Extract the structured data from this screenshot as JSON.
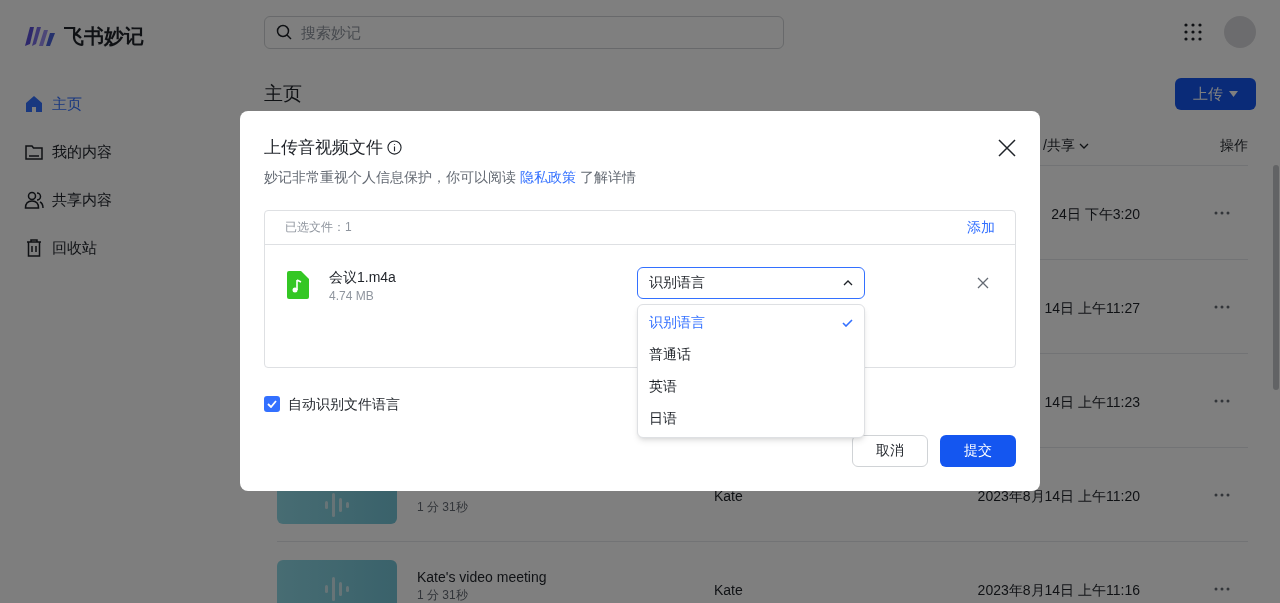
{
  "app": {
    "logo_text": "飞书妙记"
  },
  "search": {
    "placeholder": "搜索妙记"
  },
  "sidebar": {
    "items": [
      {
        "label": "主页",
        "selected": true
      },
      {
        "label": "我的内容",
        "selected": false
      },
      {
        "label": "共享内容",
        "selected": false
      },
      {
        "label": "回收站",
        "selected": false
      }
    ]
  },
  "page_title": "主页",
  "upload_button": "上传",
  "table": {
    "columns": [
      {
        "label": "/共享"
      },
      {
        "label": "操作"
      }
    ],
    "rows": [
      {
        "date": "24日 下午3:20"
      },
      {
        "date": "14日 上午11:27"
      },
      {
        "date": "14日 上午11:23"
      },
      {
        "duration": "1 分 31秒",
        "owner": "Kate",
        "date": "2023年8月14日 上午11:20"
      },
      {
        "title": "Kate's video meeting",
        "duration": "1 分 31秒",
        "owner": "Kate",
        "date": "2023年8月14日 上午11:16"
      }
    ]
  },
  "dialog": {
    "title": "上传音视频文件",
    "subtitle_before": "妙记非常重视个人信息保护，你可以阅读",
    "subtitle_link": "隐私政策",
    "subtitle_after": "了解详情",
    "selected_count": "已选文件：1",
    "add_link": "添加",
    "files": [
      {
        "name": "会议1.m4a",
        "size": "4.74 MB",
        "language_select": {
          "value": "识别语言",
          "expanded": true,
          "options": [
            {
              "label": "识别语言",
              "selected": true
            },
            {
              "label": "普通话",
              "selected": false
            },
            {
              "label": "英语",
              "selected": false
            },
            {
              "label": "日语",
              "selected": false
            }
          ]
        }
      }
    ],
    "auto_detect": {
      "label": "自动识别文件语言",
      "checked": true
    },
    "buttons": [
      {
        "label": "取消",
        "kind": "secondary"
      },
      {
        "label": "提交",
        "kind": "primary"
      }
    ]
  }
}
